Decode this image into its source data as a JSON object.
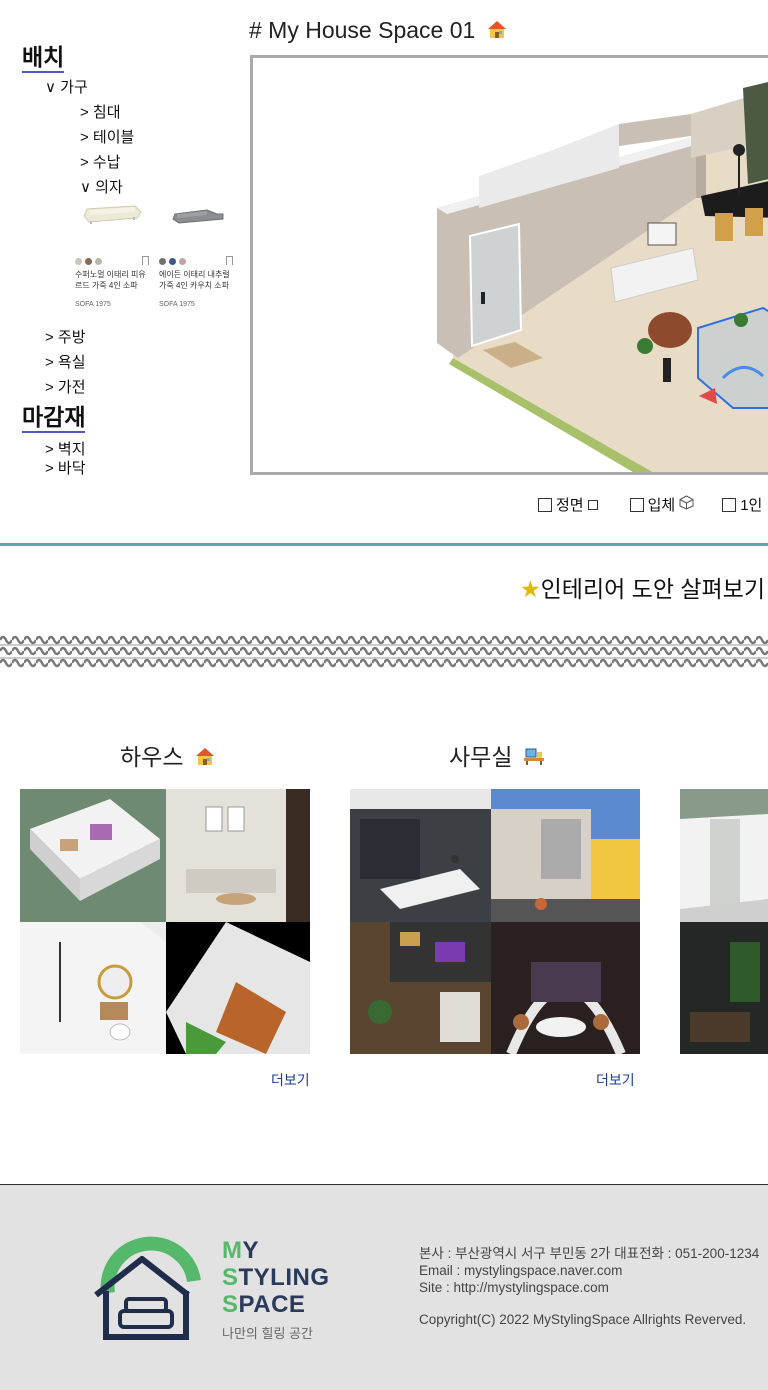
{
  "sidebar": {
    "section_layout": "배치",
    "furniture": "∨ 가구",
    "bed": "> 침대",
    "table": "> 테이블",
    "storage": "> 수납",
    "chair": "∨ 의자",
    "sofas": [
      {
        "name": "수퍼노멀 이태리 피유르드 가죽 4인 소파",
        "brand": "SOFA 1975",
        "swatches": [
          "#c8c8b8",
          "#8a6a52",
          "#b8b8a8"
        ]
      },
      {
        "name": "에이든 이태리 내추럴 가죽 4인 카우치 소파",
        "brand": "SOFA 1975",
        "swatches": [
          "#707070",
          "#3a5a86",
          "#c4a4a0"
        ]
      }
    ],
    "kitchen": "> 주방",
    "bath": "> 욕실",
    "appliance": "> 가전",
    "section_finish": "마감재",
    "wallpaper": "> 벽지",
    "floor": "> 바닥"
  },
  "viewer": {
    "title": "# My House Space 01",
    "title_icon": "house-icon",
    "options": [
      {
        "label": "정면",
        "icon": "square-icon"
      },
      {
        "label": "입체",
        "icon": "cube-icon"
      },
      {
        "label": "1인"
      }
    ]
  },
  "interior": {
    "title": "인테리어 도안 살펴보기",
    "star_color": "#e3b800"
  },
  "categories": [
    {
      "title": "하우스",
      "icon": "house-icon",
      "more": "더보기"
    },
    {
      "title": "사무실",
      "icon": "office-icon",
      "more": "더보기"
    }
  ],
  "footer": {
    "brand_lines": [
      "MY",
      "STYLING",
      "SPACE"
    ],
    "tagline": "나만의 힐링 공간",
    "address": "본사 : 부산광역시 서구 부민동 2가  대표전화 : 051-200-1234",
    "email": "Email : mystylingspace.naver.com",
    "site": "Site : http://mystylingspace.com",
    "copyright": "Copyright(C) 2022 MyStylingSpace Allrights Reverved.",
    "colors": {
      "navy": "#2a3a5a",
      "green": "#55b86a",
      "background": "#e2e2e2"
    }
  },
  "colors": {
    "accent_teal": "#5aa9a9",
    "link_blue": "#1b3e9c",
    "underline_blue": "#4a5bc4"
  }
}
